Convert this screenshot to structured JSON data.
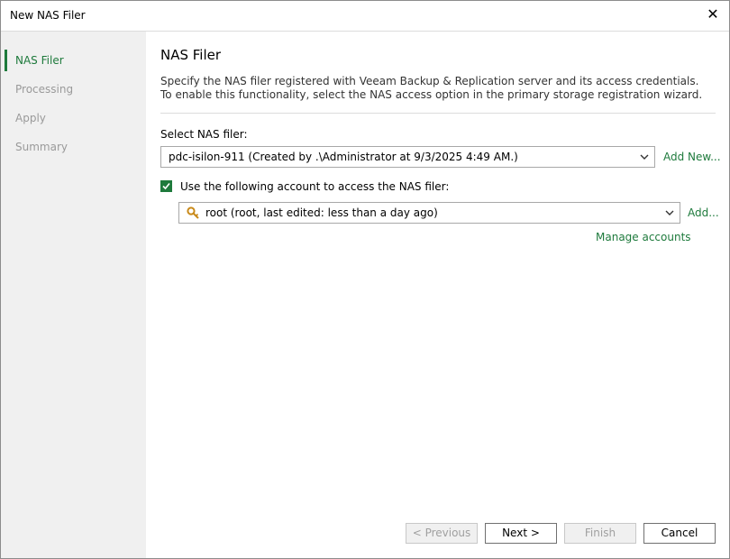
{
  "window": {
    "title": "New NAS Filer"
  },
  "steps": [
    {
      "label": "NAS Filer"
    },
    {
      "label": "Processing"
    },
    {
      "label": "Apply"
    },
    {
      "label": "Summary"
    }
  ],
  "main": {
    "heading": "NAS Filer",
    "description": "Specify the NAS filer registered with Veeam Backup & Replication server and its access credentials. To enable this functionality, select the NAS access option in the primary storage registration wizard.",
    "select_nas_label": "Select NAS filer:",
    "nas_filer_value": "pdc-isilon-911 (Created by .\\Administrator at 9/3/2025 4:49 AM.)",
    "add_new_link": "Add New...",
    "use_account_label": "Use the following account to access the NAS filer:",
    "use_account_checked": true,
    "account_value": "root (root, last edited: less than a day ago)",
    "add_link": "Add...",
    "manage_accounts_link": "Manage accounts"
  },
  "footer": {
    "previous": "< Previous",
    "next": "Next >",
    "finish": "Finish",
    "cancel": "Cancel"
  },
  "colors": {
    "accent": "#1e7a3c",
    "sidebar_bg": "#f0f0f0"
  }
}
